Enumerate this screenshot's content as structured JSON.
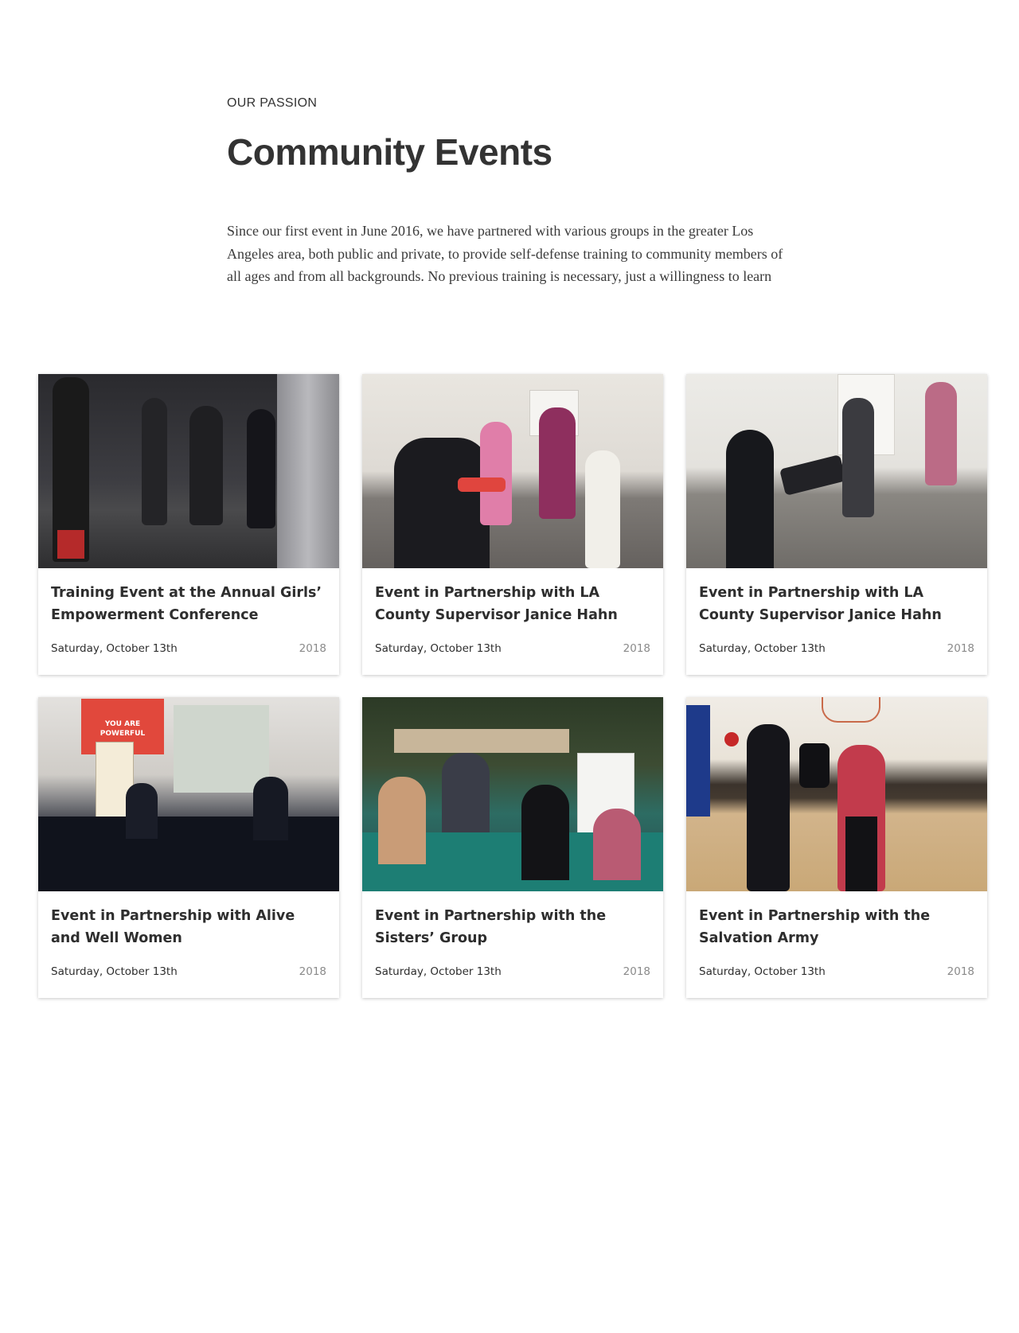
{
  "intro": {
    "eyebrow": "OUR PASSION",
    "heading": "Community Events",
    "description": "Since our first event in June 2016, we have partnered with various groups in the greater Los Angeles area, both public and private, to provide self-defense training to community members of all ages and from all backgrounds. No previous training is necessary, just a willingness to learn"
  },
  "events": [
    {
      "title": "Training Event at the Annual Girls’ Empowerment Conference",
      "date": "Saturday, October 13th",
      "year": "2018"
    },
    {
      "title": "Event in Partnership with LA County Supervisor Janice Hahn",
      "date": "Saturday, October 13th",
      "year": "2018"
    },
    {
      "title": "Event in Partnership with LA County Supervisor Janice Hahn",
      "date": "Saturday, October 13th",
      "year": "2018"
    },
    {
      "title": "Event in Partnership with Alive and Well Women",
      "date": "Saturday, October 13th",
      "year": "2018",
      "photo_banner": "YOU ARE POWERFUL"
    },
    {
      "title": "Event in Partnership with the Sisters’ Group",
      "date": "Saturday, October 13th",
      "year": "2018"
    },
    {
      "title": "Event in Partnership with the Salvation Army",
      "date": "Saturday, October 13th",
      "year": "2018"
    }
  ],
  "colors": {
    "text": "#333333",
    "muted": "#8a8a8a",
    "banner_red": "#e1483c"
  }
}
